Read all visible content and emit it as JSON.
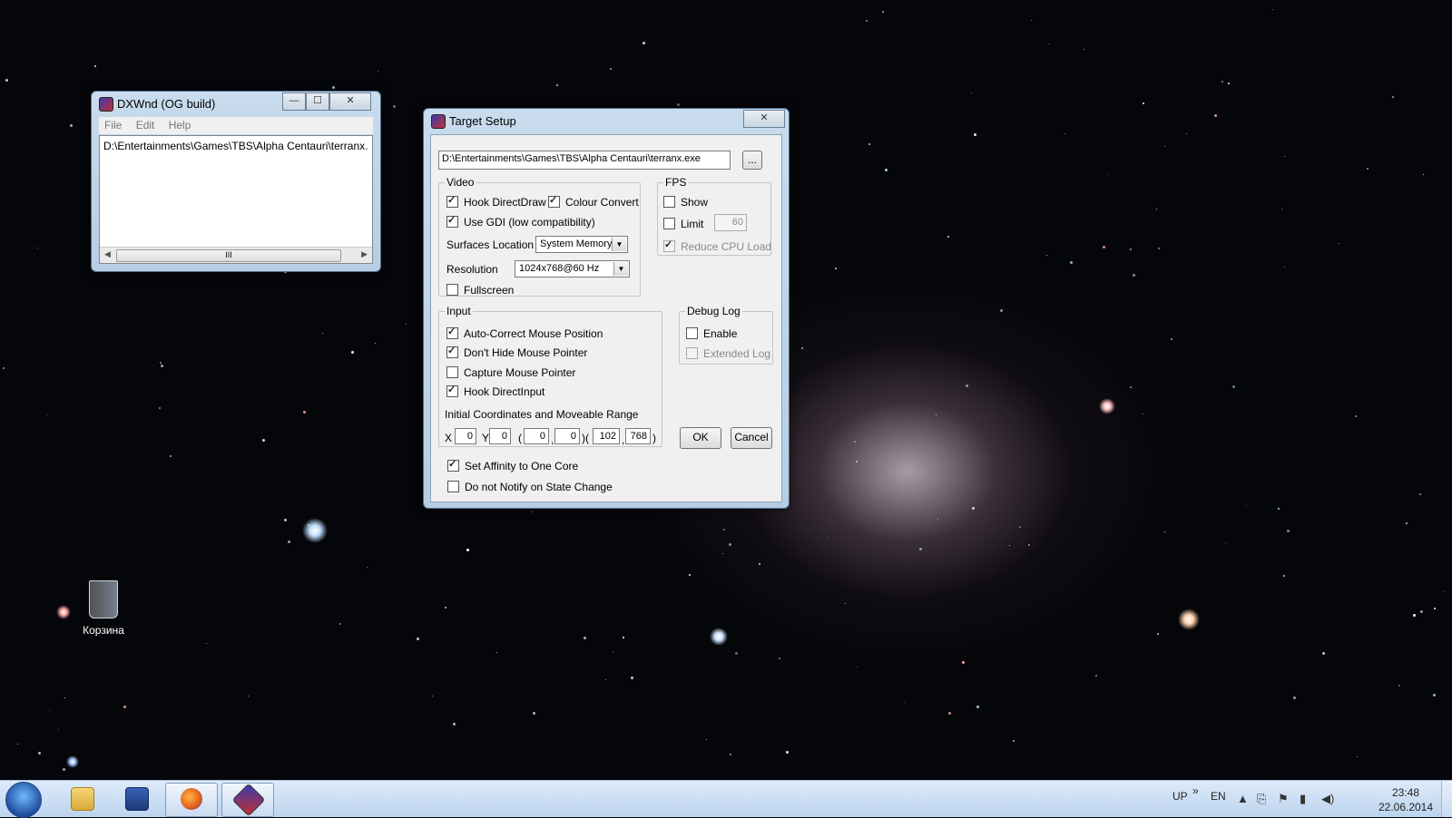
{
  "dxwnd": {
    "title": "DXWnd (OG build)",
    "menu": [
      "File",
      "Edit",
      "Help"
    ],
    "list_item": "D:\\Entertainments\\Games\\TBS\\Alpha Centauri\\terranx.exe",
    "scroll_thumb": "III",
    "caption_buttons": {
      "minimize": "—",
      "maximize": "☐",
      "close": "✕"
    }
  },
  "setup": {
    "title": "Target Setup",
    "close": "✕",
    "path": "D:\\Entertainments\\Games\\TBS\\Alpha Centauri\\terranx.exe",
    "browse_label": "...",
    "video": {
      "legend": "Video",
      "hook_directdraw": {
        "label": "Hook DirectDraw",
        "checked": true
      },
      "colour_convert": {
        "label": "Colour Convert",
        "checked": true
      },
      "use_gdi": {
        "label": "Use GDI (low compatibility)",
        "checked": true
      },
      "surfaces_label": "Surfaces Location",
      "surfaces_value": "System Memory",
      "resolution_label": "Resolution",
      "resolution_value": "1024x768@60 Hz",
      "fullscreen": {
        "label": "Fullscreen",
        "checked": false
      }
    },
    "fps": {
      "legend": "FPS",
      "show": {
        "label": "Show",
        "checked": false
      },
      "limit": {
        "label": "Limit",
        "checked": false
      },
      "limit_value": "60",
      "reduce_cpu": {
        "label": "Reduce CPU Load",
        "checked": true,
        "disabled": true
      }
    },
    "input": {
      "legend": "Input",
      "auto_correct": {
        "label": "Auto-Correct Mouse Position",
        "checked": true
      },
      "dont_hide": {
        "label": "Don't Hide Mouse Pointer",
        "checked": true
      },
      "capture": {
        "label": "Capture Mouse Pointer",
        "checked": false
      },
      "hook_directinput": {
        "label": "Hook DirectInput",
        "checked": true
      },
      "coords_label": "Initial Coordinates and Moveable Range",
      "x_label": "X",
      "y_label": "Y",
      "x_value": "0",
      "y_value": "0",
      "range_values": [
        "0",
        "0",
        "102",
        "768"
      ],
      "range_seps": [
        "(",
        ",",
        ")(",
        ",",
        ")"
      ]
    },
    "debug": {
      "legend": "Debug Log",
      "enable": {
        "label": "Enable",
        "checked": false
      },
      "extended": {
        "label": "Extended Log",
        "checked": false,
        "disabled": true
      }
    },
    "ok_label": "OK",
    "cancel_label": "Cancel",
    "affinity": {
      "label": "Set Affinity to One Core",
      "checked": true
    },
    "no_notify": {
      "label": "Do not Notify on State Change",
      "checked": false
    }
  },
  "desktop": {
    "recycle_label": "Корзина"
  },
  "taskbar": {
    "apps": [
      "start-orb",
      "file-explorer",
      "floppy-save",
      "firefox",
      "dxwnd"
    ],
    "tray_up": "UP",
    "tray_chevron": "»",
    "lang": "EN",
    "time": "23:48",
    "date": "22.06.2014"
  }
}
